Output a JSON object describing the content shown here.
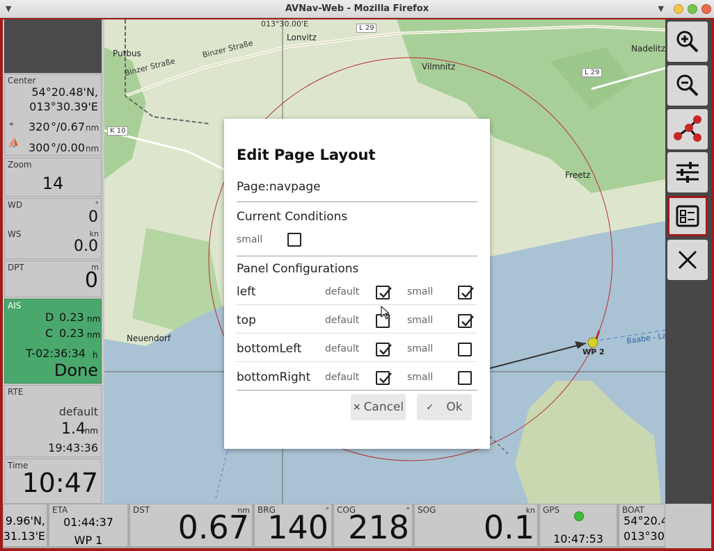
{
  "window": {
    "title": "AVNav-Web - Mozilla Firefox"
  },
  "map": {
    "coord_label": "013°30.00'E",
    "places": [
      "Putbus",
      "Lonvitz",
      "Vilmnitz",
      "Nadelitz",
      "Freetz",
      "Neuendorf"
    ],
    "roads": [
      "Binzer Straße",
      "Binzer Straße",
      "K 10",
      "L 29",
      "L 29"
    ],
    "route_label": "Baabe - Lau",
    "waypoint": "WP 2",
    "colors": {
      "water": "#aac3d4",
      "land": "#dde6cd",
      "forest": "#a9cf98",
      "route": "#b62b2b"
    }
  },
  "left": {
    "center": {
      "label": "Center",
      "lat": "54°20.48'N,",
      "lon": "013°30.39'E",
      "row1_value": "320",
      "row1_unit": "°/0.67",
      "row1_unit2": "nm",
      "row2_value": "300",
      "row2_unit": "°/0.00",
      "row2_unit2": "nm"
    },
    "zoom": {
      "label": "Zoom",
      "value": "14"
    },
    "wind": {
      "wd_label": "WD",
      "wd_unit": "°",
      "wd_value": "0",
      "ws_label": "WS",
      "ws_unit": "kn",
      "ws_value": "0.0"
    },
    "depth": {
      "label": "DPT",
      "unit": "m",
      "value": "0"
    },
    "ais": {
      "label": "AIS",
      "d_label": "D",
      "d_value": "0.23",
      "d_unit": "nm",
      "c_label": "C",
      "c_value": "0.23",
      "c_unit": "nm",
      "t_value": "T-02:36:34",
      "t_unit": "h",
      "status": "Done",
      "color": "#4aa86c"
    },
    "route": {
      "label": "RTE",
      "name": "default",
      "dist": "1.4",
      "dist_unit": "nm",
      "time": "19:43:36"
    },
    "time": {
      "label": "Time",
      "value": "10:47"
    }
  },
  "bottom": {
    "pos": {
      "lat": "9.96'N,",
      "lon": "31.13'E"
    },
    "eta": {
      "label": "ETA",
      "time": "01:44:37",
      "wp": "WP 1"
    },
    "dst": {
      "label": "DST",
      "unit": "nm",
      "value": "0.67"
    },
    "brg": {
      "label": "BRG",
      "unit": "°",
      "value": "140"
    },
    "cog": {
      "label": "COG",
      "unit": "°",
      "value": "218"
    },
    "sog": {
      "label": "SOG",
      "unit": "kn",
      "value": "0.1"
    },
    "gps": {
      "label": "GPS",
      "time": "10:47:53",
      "status_color": "#3cbf3c"
    },
    "boat": {
      "label": "BOAT",
      "lat": "54°20.4",
      "lon": "013°30"
    }
  },
  "toolbar": {
    "icons": [
      "zoom-in-icon",
      "zoom-out-icon",
      "route-icon",
      "sliders-icon",
      "layout-icon",
      "close-icon"
    ]
  },
  "dialog": {
    "title": "Edit Page Layout",
    "page": "Page:navpage",
    "current_conditions": {
      "heading": "Current Conditions",
      "small_label": "small",
      "small_checked": false
    },
    "panels": {
      "heading": "Panel Configurations",
      "default_label": "default",
      "small_label": "small",
      "rows": [
        {
          "name": "left",
          "default": true,
          "small": true
        },
        {
          "name": "top",
          "default": false,
          "small": true
        },
        {
          "name": "bottomLeft",
          "default": true,
          "small": false
        },
        {
          "name": "bottomRight",
          "default": true,
          "small": false
        }
      ]
    },
    "cancel_label": "Cancel",
    "ok_label": "Ok",
    "cancel_symbol": "×",
    "ok_symbol": "✓"
  }
}
